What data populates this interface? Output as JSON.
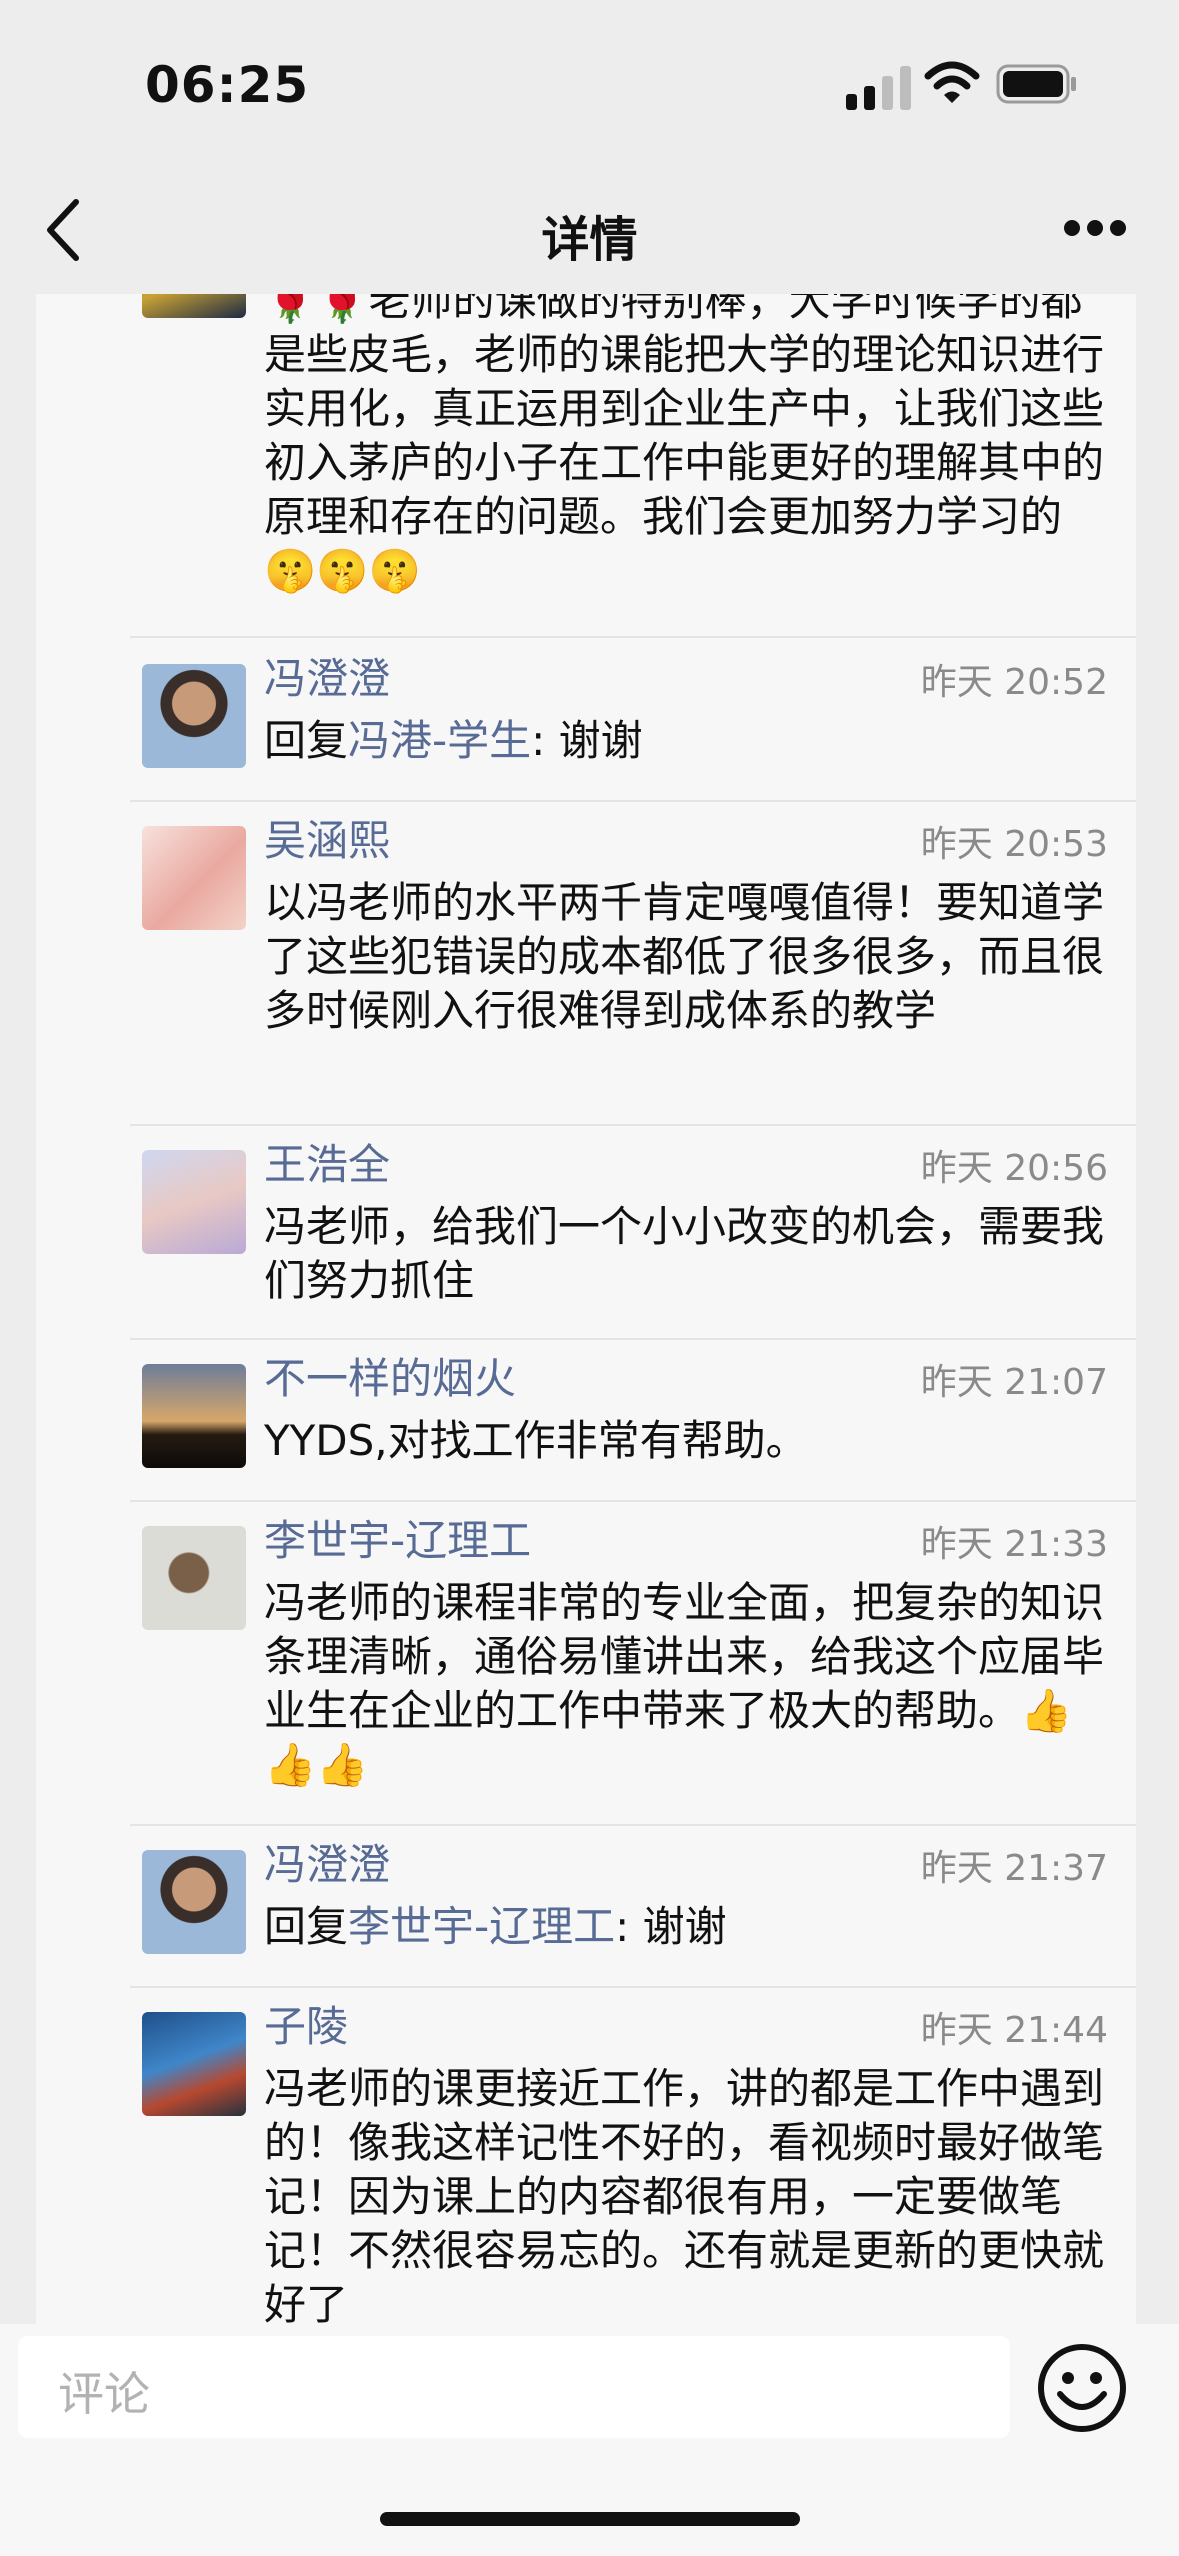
{
  "status_bar": {
    "time": "06:25"
  },
  "nav": {
    "title": "详情",
    "back_icon": "chevron-left-icon",
    "more_icon": "more-dots-icon"
  },
  "comments": [
    {
      "text": "🌹🌹老师的课做的特别棒，大学时候学的都是些皮毛，老师的课能把大学的理论知识进行实用化，真正运用到企业生产中，让我们这些初入茅庐的小子在工作中能更好的理解其中的原理和存在的问题。我们会更加努力学习的🤫🤫🤫"
    },
    {
      "name": "冯澄澄",
      "time": "昨天 20:52",
      "reply_prefix": "回复",
      "reply_to": "冯港-学生",
      "reply_text": ": 谢谢"
    },
    {
      "name": "吴涵熙",
      "time": "昨天 20:53",
      "text": "以冯老师的水平两千肯定嘎嘎值得！要知道学了这些犯错误的成本都低了很多很多，而且很多时候刚入行很难得到成体系的教学"
    },
    {
      "name": "王浩全",
      "time": "昨天 20:56",
      "text": "冯老师，给我们一个小小改变的机会，需要我们努力抓住"
    },
    {
      "name": "不一样的烟火",
      "time": "昨天 21:07",
      "text": "YYDS,对找工作非常有帮助。"
    },
    {
      "name": "李世宇-辽理工",
      "time": "昨天 21:33",
      "text": "冯老师的课程非常的专业全面，把复杂的知识条理清晰，通俗易懂讲出来，给我这个应届毕业生在企业的工作中带来了极大的帮助。👍👍👍"
    },
    {
      "name": "冯澄澄",
      "time": "昨天 21:37",
      "reply_prefix": "回复",
      "reply_to": "李世宇-辽理工",
      "reply_text": ": 谢谢"
    },
    {
      "name": "子陵",
      "time": "昨天 21:44",
      "text": "冯老师的课更接近工作，讲的都是工作中遇到的！像我这样记性不好的，看视频时最好做笔记！因为课上的内容都很有用，一定要做笔记！不然很容易忘的。还有就是更新的更快就好了"
    }
  ],
  "input": {
    "placeholder": "评论",
    "emoji_icon": "emoji-smile-icon"
  }
}
